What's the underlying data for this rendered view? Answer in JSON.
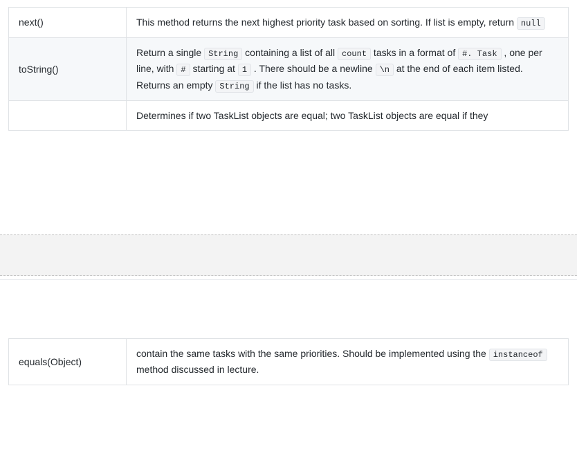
{
  "rows": {
    "next": {
      "method": "next()",
      "desc_prefix": "This method returns the next highest priority task based on sorting. If list is empty, return ",
      "code_null": "null"
    },
    "tostring": {
      "method": "toString()",
      "part1_a": "Return a single ",
      "code_string1": "String",
      "part1_b": " containing a list of all ",
      "code_count": "count",
      "part1_c": " tasks in a format of ",
      "code_format": "#. Task",
      "part1_d": " , one per line, with ",
      "code_hash": "#",
      "part1_e": " starting at ",
      "code_one": "1",
      "part1_f": " . There should be a newline ",
      "code_newline": "\\n",
      "part1_g": " at the end of each item listed.",
      "part2_a": "Returns an empty ",
      "code_string2": "String",
      "part2_b": " if the list has no tasks."
    },
    "equals_top": {
      "desc": "Determines if two TaskList objects are equal; two TaskList objects are equal if they"
    },
    "equals_bottom": {
      "method": "equals(Object)",
      "part_a": "contain the same tasks with the same priorities. Should be implemented using the ",
      "code_instanceof": "instanceof",
      "part_b": " method discussed in lecture."
    }
  }
}
